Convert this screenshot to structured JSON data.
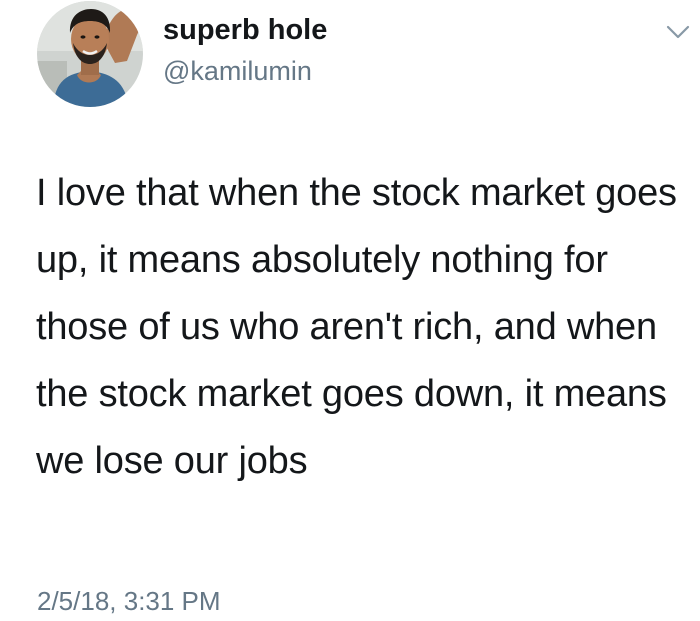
{
  "tweet": {
    "author": {
      "display_name": "superb hole",
      "handle": "@kamilumin",
      "avatar_icon": "profile-photo"
    },
    "menu_icon": "chevron-down-icon",
    "text": "I love that when the stock market goes up, it means absolutely nothing for those of us who aren't rich, and when the stock market goes down, it means we lose our jobs",
    "timestamp": "2/5/18, 3:31 PM"
  },
  "colors": {
    "text_primary": "#14171a",
    "text_secondary": "#657786",
    "background": "#ffffff"
  }
}
